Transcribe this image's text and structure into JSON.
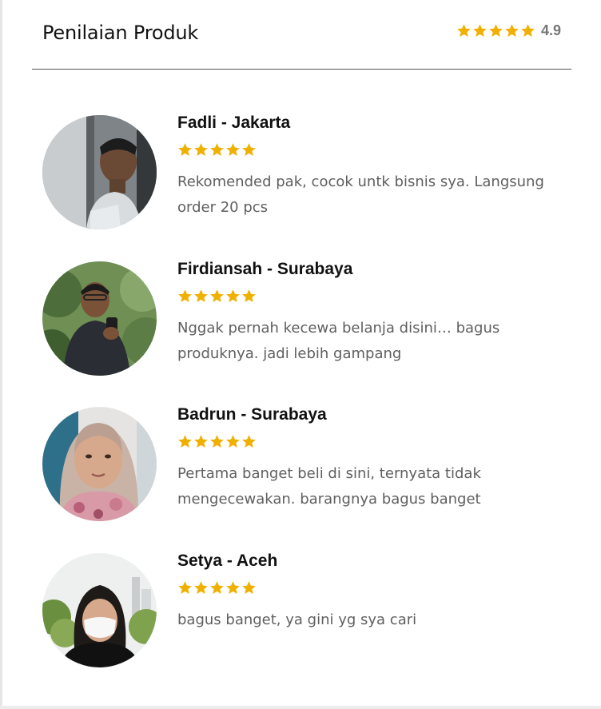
{
  "header": {
    "title": "Penilaian Produk",
    "overall_stars": 5,
    "overall_rating": "4.9"
  },
  "colors": {
    "star": "#f0b000",
    "title_text": "#111111",
    "comment_text": "#5f5f5f",
    "divider": "#555555"
  },
  "icons": {
    "star": "star-icon",
    "avatar": "user-photo"
  },
  "reviews": [
    {
      "name": "Fadli - Jakarta",
      "stars": 5,
      "comment": "Rekomended pak, cocok untk bisnis sya. Langsung order 20 pcs"
    },
    {
      "name": "Firdiansah - Surabaya",
      "stars": 5,
      "comment": "Nggak pernah kecewa belanja disini… bagus produknya. jadi lebih gampang"
    },
    {
      "name": "Badrun - Surabaya",
      "stars": 5,
      "comment": "Pertama banget beli di sini, ternyata tidak mengecewakan. barangnya bagus banget"
    },
    {
      "name": "Setya - Aceh",
      "stars": 5,
      "comment": "bagus banget, ya gini yg sya cari"
    }
  ]
}
